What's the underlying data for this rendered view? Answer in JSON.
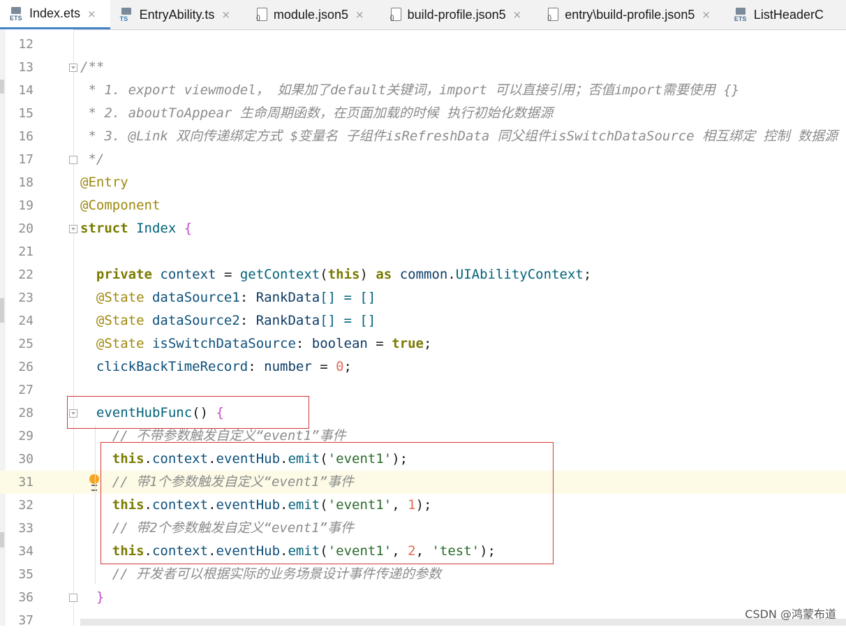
{
  "tabs": [
    {
      "label": "Index.ets",
      "icon": "ets-file-icon",
      "icon_text": "ETS",
      "active": true
    },
    {
      "label": "EntryAbility.ts",
      "icon": "ts-file-icon",
      "icon_text": "TS"
    },
    {
      "label": "module.json5",
      "icon": "json-file-icon",
      "icon_text": "{}"
    },
    {
      "label": "build-profile.json5",
      "icon": "json-file-icon",
      "icon_text": "{}"
    },
    {
      "label": "entry\\build-profile.json5",
      "icon": "json-file-icon",
      "icon_text": "{}"
    },
    {
      "label": "ListHeaderC",
      "icon": "ets-file-icon",
      "icon_text": "ETS"
    }
  ],
  "close_glyph": "×",
  "editor": {
    "line_numbers": [
      "12",
      "13",
      "14",
      "15",
      "16",
      "17",
      "18",
      "19",
      "20",
      "21",
      "22",
      "23",
      "24",
      "25",
      "26",
      "27",
      "28",
      "29",
      "30",
      "31",
      "32",
      "33",
      "34",
      "35",
      "36",
      "37"
    ],
    "lines": {
      "l13": "/**",
      "l14": " * 1. export viewmodel， 如果加了default关键词，import 可以直接引用；否值import需要使用 {}",
      "l15": " * 2. aboutToAppear 生命周期函数，在页面加载的时候 执行初始化数据源",
      "l16": " * 3. @Link 双向传递绑定方式 $变量名 子组件isRefreshData 同父组件isSwitchDataSource 相互绑定 控制 数据源",
      "l17": " */",
      "l18": "@Entry",
      "l19": "@Component",
      "l20_kw": "struct",
      "l20_name": "Index",
      "l20_brace": "{",
      "l22": {
        "kw": "private",
        "name": "context",
        "eq": "=",
        "fn": "getContext",
        "this": "this",
        "as": "as",
        "ns": "common",
        "type": "UIAbilityContext"
      },
      "l23": {
        "ann": "@State",
        "name": "dataSource1",
        "type": "RankData",
        "rest": "[] = []"
      },
      "l24": {
        "ann": "@State",
        "name": "dataSource2",
        "type": "RankData",
        "rest": "[] = []"
      },
      "l25": {
        "ann": "@State",
        "name": "isSwitchDataSource",
        "type": "boolean",
        "val": "true"
      },
      "l26": {
        "name": "clickBackTimeRecord",
        "type": "number",
        "val": "0"
      },
      "l28": {
        "fn": "eventHubFunc",
        "brace": "{"
      },
      "l29": "// 不带参数触发自定义“event1”事件",
      "l30": {
        "this": "this",
        "ctx": "context",
        "hub": "eventHub",
        "fn": "emit",
        "args": "'event1'",
        "num": ""
      },
      "l31": "// 带1个参数触发自定义“event1”事件",
      "l32": {
        "this": "this",
        "ctx": "context",
        "hub": "eventHub",
        "fn": "emit",
        "args": "'event1'",
        "num": "1"
      },
      "l33": "// 带2个参数触发自定义“event1”事件",
      "l34": {
        "this": "this",
        "ctx": "context",
        "hub": "eventHub",
        "fn": "emit",
        "args": "'event1'",
        "num": "2",
        "str2": "'test'"
      },
      "l35": "// 开发者可以根据实际的业务场景设计事件传递的参数",
      "l36": "}"
    }
  },
  "watermark": "CSDN @鸿蒙布道"
}
